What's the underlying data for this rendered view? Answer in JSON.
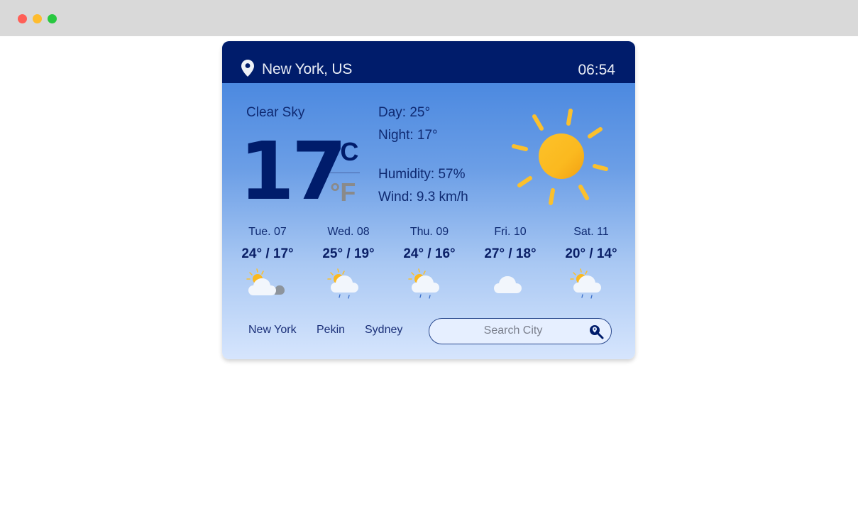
{
  "window": {
    "controls": [
      "close",
      "minimize",
      "maximize"
    ]
  },
  "header": {
    "location_icon": "map-pin-icon",
    "location": "New York, US",
    "time": "06:54"
  },
  "current": {
    "condition": "Clear Sky",
    "temperature": "17",
    "unit_celsius": "°C",
    "unit_fahrenheit": "°F",
    "active_unit": "celsius",
    "day": "Day: 25°",
    "night": "Night: 17°",
    "humidity": "Humidity: 57%",
    "wind": "Wind: 9.3 km/h",
    "icon": "sun-icon"
  },
  "forecast": [
    {
      "day": "Tue. 07",
      "temps": "24° / 17°",
      "icon": "partly-cloudy-dark-cloud-icon"
    },
    {
      "day": "Wed. 08",
      "temps": "25° / 19°",
      "icon": "sun-cloud-rain-icon"
    },
    {
      "day": "Thu. 09",
      "temps": "24° / 16°",
      "icon": "sun-cloud-rain-icon"
    },
    {
      "day": "Fri. 10",
      "temps": "27° / 18°",
      "icon": "cloud-icon"
    },
    {
      "day": "Sat. 11",
      "temps": "20° / 14°",
      "icon": "sun-cloud-rain-icon"
    }
  ],
  "quick_cities": [
    "New York",
    "Pekin",
    "Sydney"
  ],
  "search": {
    "placeholder": "Search City",
    "value": "",
    "button_icon": "search-location-icon"
  },
  "colors": {
    "header_bg": "#001c6b",
    "text_primary": "#0f2a72",
    "sun": "#fbbc23",
    "fahrenheit_inactive": "#8a8a8a"
  }
}
